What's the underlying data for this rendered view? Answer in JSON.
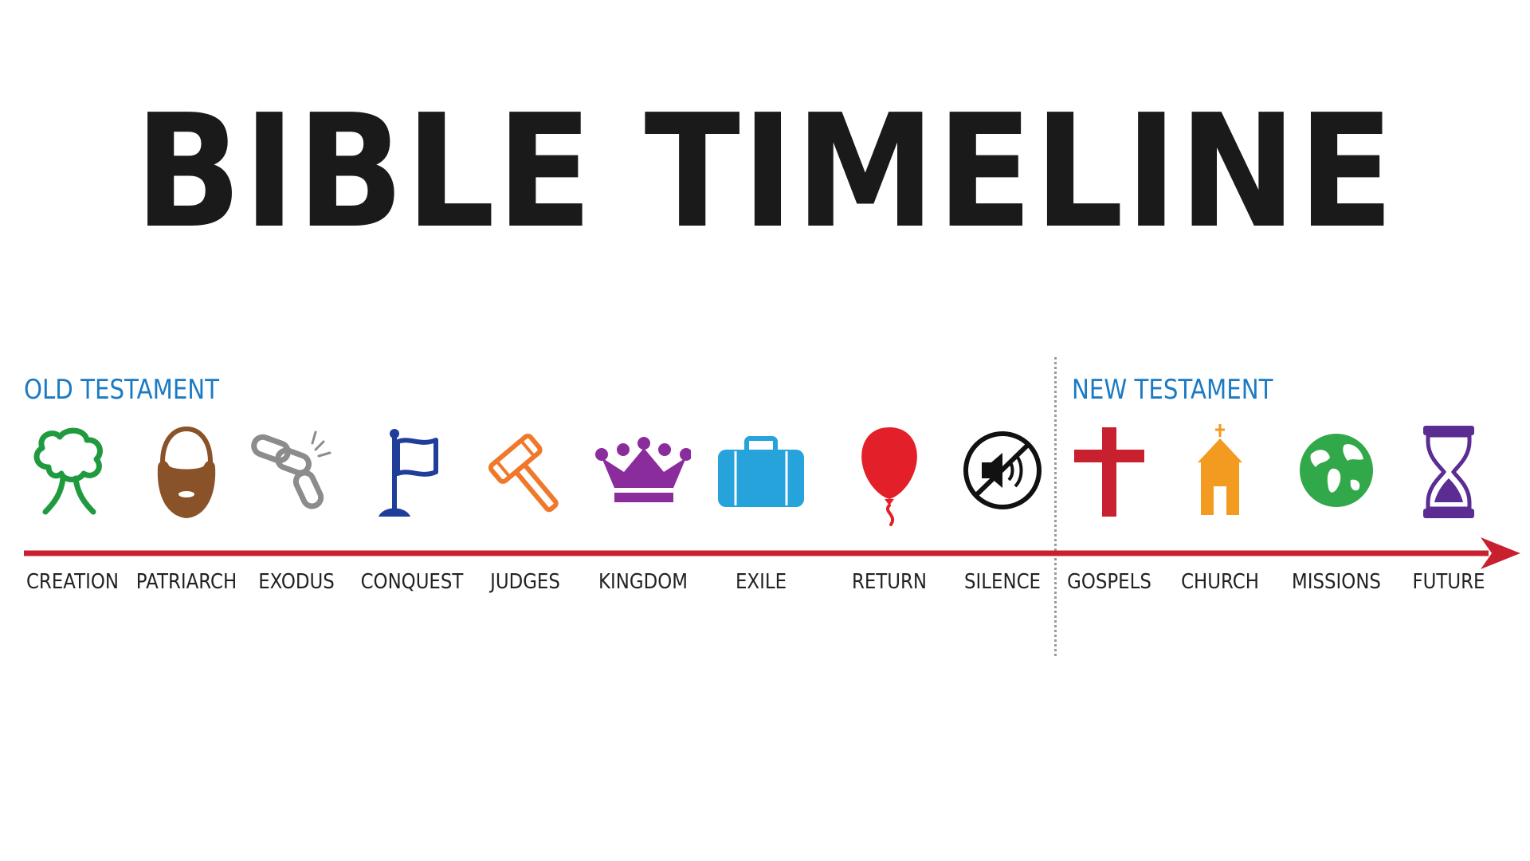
{
  "title": "BIBLE TIMELINE",
  "sections": {
    "old": {
      "label": "OLD TESTAMENT",
      "color": "#1b7ac4"
    },
    "new": {
      "label": "NEW TESTAMENT",
      "color": "#1b7ac4"
    }
  },
  "arrow_color": "#c8202f",
  "divider_color": "#9a9a9a",
  "eras": [
    {
      "label": "CREATION",
      "icon": "tree-icon",
      "color": "#1f9a3e"
    },
    {
      "label": "PATRIARCH",
      "icon": "bearded-man-icon",
      "color": "#8a5228"
    },
    {
      "label": "EXODUS",
      "icon": "broken-chain-icon",
      "color": "#8c8c8c"
    },
    {
      "label": "CONQUEST",
      "icon": "flag-icon",
      "color": "#1f3e9a"
    },
    {
      "label": "JUDGES",
      "icon": "gavel-icon",
      "color": "#f0782a"
    },
    {
      "label": "KINGDOM",
      "icon": "crown-icon",
      "color": "#8a2c9c"
    },
    {
      "label": "EXILE",
      "icon": "suitcase-icon",
      "color": "#27a3dc"
    },
    {
      "label": "RETURN",
      "icon": "balloon-icon",
      "color": "#e3202a"
    },
    {
      "label": "SILENCE",
      "icon": "mute-icon",
      "color": "#111111"
    },
    {
      "label": "GOSPELS",
      "icon": "cross-icon",
      "color": "#c8202f"
    },
    {
      "label": "CHURCH",
      "icon": "church-icon",
      "color": "#f39a21"
    },
    {
      "label": "MISSIONS",
      "icon": "globe-icon",
      "color": "#31a84a"
    },
    {
      "label": "FUTURE",
      "icon": "hourglass-icon",
      "color": "#5b2c91"
    }
  ]
}
